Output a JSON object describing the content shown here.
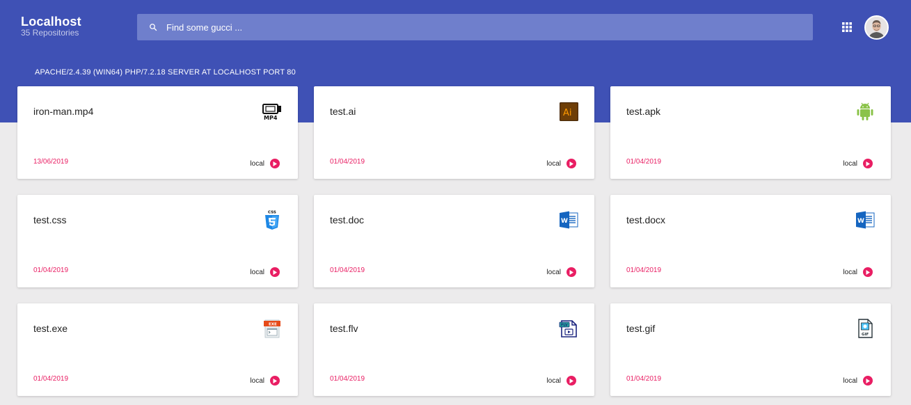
{
  "header": {
    "title": "Localhost",
    "subtitle": "35 Repositories",
    "search_placeholder": "Find some gucci ...",
    "server_info": "APACHE/2.4.39 (WIN64) PHP/7.2.18 SERVER AT LOCALHOST PORT 80"
  },
  "colors": {
    "primary": "#3f51b5",
    "accent": "#e91e63",
    "background": "#ecebec"
  },
  "files": [
    {
      "name": "iron-man.mp4",
      "date": "13/06/2019",
      "source": "local",
      "icon": "mp4-icon"
    },
    {
      "name": "test.ai",
      "date": "01/04/2019",
      "source": "local",
      "icon": "illustrator-icon"
    },
    {
      "name": "test.apk",
      "date": "01/04/2019",
      "source": "local",
      "icon": "android-icon"
    },
    {
      "name": "test.css",
      "date": "01/04/2019",
      "source": "local",
      "icon": "css3-icon"
    },
    {
      "name": "test.doc",
      "date": "01/04/2019",
      "source": "local",
      "icon": "word-icon"
    },
    {
      "name": "test.docx",
      "date": "01/04/2019",
      "source": "local",
      "icon": "word-icon"
    },
    {
      "name": "test.exe",
      "date": "01/04/2019",
      "source": "local",
      "icon": "exe-icon"
    },
    {
      "name": "test.flv",
      "date": "01/04/2019",
      "source": "local",
      "icon": "flv-icon"
    },
    {
      "name": "test.gif",
      "date": "01/04/2019",
      "source": "local",
      "icon": "gif-icon"
    }
  ]
}
